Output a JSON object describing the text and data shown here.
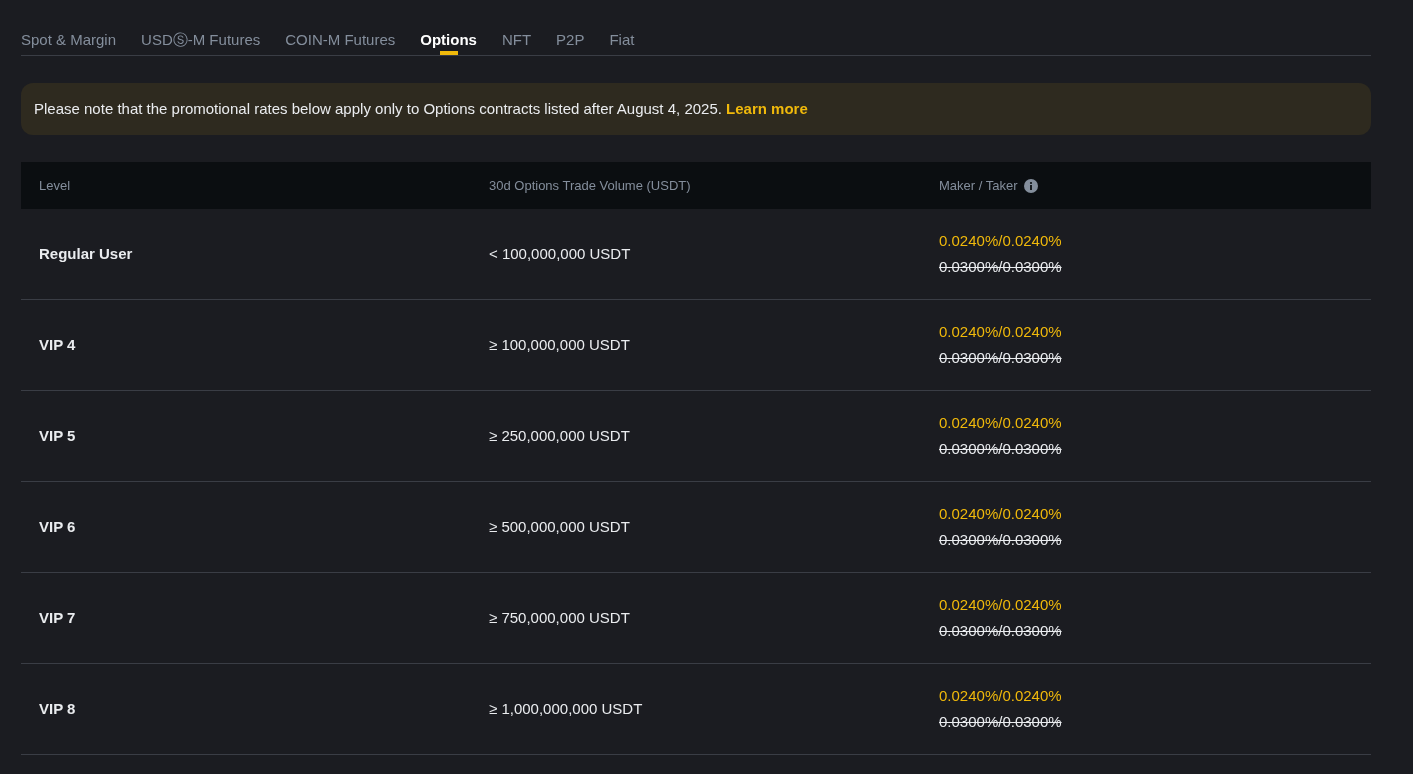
{
  "tabs": [
    {
      "label": "Spot & Margin",
      "selected": false
    },
    {
      "label": "USDⓈ-M Futures",
      "selected": false
    },
    {
      "label": "COIN-M Futures",
      "selected": false
    },
    {
      "label": "Options",
      "selected": true
    },
    {
      "label": "NFT",
      "selected": false
    },
    {
      "label": "P2P",
      "selected": false
    },
    {
      "label": "Fiat",
      "selected": false
    }
  ],
  "notice": {
    "text": "Please note that the promotional rates below apply only to Options contracts listed after August 4, 2025.",
    "link": "Learn more"
  },
  "table": {
    "columns": [
      "Level",
      "30d Options Trade Volume (USDT)",
      "Maker / Taker"
    ],
    "rows": [
      {
        "level": "Regular User",
        "volume": "< 100,000,000 USDT",
        "promo_rate": "0.0240%/0.0240%",
        "original_rate": "0.0300%/0.0300%"
      },
      {
        "level": "VIP 4",
        "volume": "≥ 100,000,000 USDT",
        "promo_rate": "0.0240%/0.0240%",
        "original_rate": "0.0300%/0.0300%"
      },
      {
        "level": "VIP 5",
        "volume": "≥ 250,000,000 USDT",
        "promo_rate": "0.0240%/0.0240%",
        "original_rate": "0.0300%/0.0300%"
      },
      {
        "level": "VIP 6",
        "volume": "≥ 500,000,000 USDT",
        "promo_rate": "0.0240%/0.0240%",
        "original_rate": "0.0300%/0.0300%"
      },
      {
        "level": "VIP 7",
        "volume": "≥ 750,000,000 USDT",
        "promo_rate": "0.0240%/0.0240%",
        "original_rate": "0.0300%/0.0300%"
      },
      {
        "level": "VIP 8",
        "volume": "≥ 1,000,000,000 USDT",
        "promo_rate": "0.0240%/0.0240%",
        "original_rate": "0.0300%/0.0300%"
      }
    ]
  }
}
